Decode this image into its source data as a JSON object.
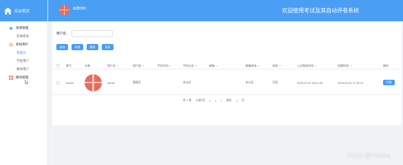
{
  "sidebar": {
    "brand": "后台首页",
    "menus": [
      {
        "label": "资源管理",
        "icon": "star-icon",
        "subs": [
          {
            "label": "在线考试",
            "active": false
          }
        ]
      },
      {
        "label": "系统用户",
        "icon": "gear-icon",
        "subs": [
          {
            "label": "管理员",
            "active": true
          },
          {
            "label": "学生用户",
            "active": false
          },
          {
            "label": "教师用户",
            "active": false
          }
        ]
      },
      {
        "label": "模块管理",
        "icon": "grid-icon",
        "subs": []
      }
    ]
  },
  "topbar": {
    "username": "admin",
    "title": "欢迎使用考试及其自动评卷系统"
  },
  "search": {
    "label": "用户名：",
    "placeholder": ""
  },
  "buttons": {
    "query": "查询",
    "add": "新增",
    "delete": "删除",
    "print": "报表"
  },
  "table": {
    "columns": [
      "索引",
      "头像",
      "用户名",
      "用户组",
      "手机号码",
      "手机认证",
      "邮箱",
      "邮箱状态",
      "状态",
      "上次登录时间",
      "创建时间",
      "操作"
    ],
    "rows": [
      {
        "index": "admin",
        "username": "admin",
        "group": "管理员",
        "phone": "",
        "phone_auth": "未认证",
        "email": "",
        "email_state": "未认证",
        "state": "可用",
        "last_login": "2023-03-31 18:21:49",
        "created": "2023-03-31 17:35:13",
        "action": "详情"
      }
    ]
  },
  "pager": {
    "total": "共 1 条",
    "page_size": "10条/页",
    "prev": "<",
    "current": "1",
    "next": ">",
    "goto_label": "前往",
    "goto_value": "1",
    "goto_suffix": "页"
  },
  "watermark": "CSDN @VXbishe",
  "colors": {
    "primary": "#409eff",
    "header": "#4a9ff5",
    "avatar": "#ec6a57"
  }
}
